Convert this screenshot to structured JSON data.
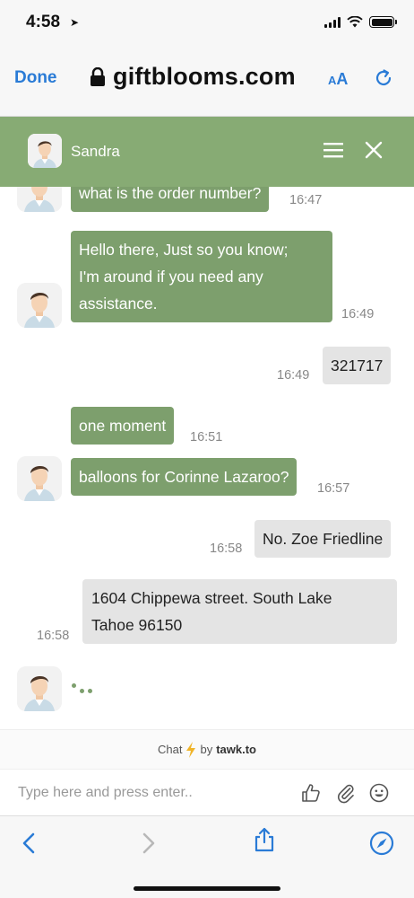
{
  "status_bar": {
    "time": "4:58"
  },
  "browser": {
    "done_label": "Done",
    "url": "giftblooms.com",
    "aa_small": "A",
    "aa_big": "A"
  },
  "chat_header": {
    "agent_name": "Sandra"
  },
  "messages": [
    {
      "sender": "agent",
      "text": "what is the order number?",
      "time": "16:47"
    },
    {
      "sender": "agent",
      "lines": [
        "Hello there, Just so you know;",
        "I'm around if you need any",
        "assistance."
      ],
      "time": "16:49"
    },
    {
      "sender": "visitor",
      "text": "321717",
      "time": "16:49"
    },
    {
      "sender": "agent",
      "text": "one moment",
      "time": "16:51"
    },
    {
      "sender": "agent",
      "text": "balloons for Corinne Lazaroo?",
      "time": "16:57"
    },
    {
      "sender": "visitor",
      "text": "No. Zoe Friedline",
      "time": "16:58"
    },
    {
      "sender": "visitor",
      "lines": [
        "1604 Chippewa street. South Lake",
        "Tahoe 96150"
      ],
      "time": "16:58"
    }
  ],
  "powered_by": {
    "prefix": "Chat",
    "by": "by",
    "brand": "tawk.to"
  },
  "composer": {
    "placeholder": "Type here and press enter.."
  },
  "colors": {
    "header_green": "#87ab74",
    "agent_bubble": "#7d9f6d",
    "visitor_bubble": "#e4e4e4",
    "ios_blue": "#2a7bd6"
  }
}
